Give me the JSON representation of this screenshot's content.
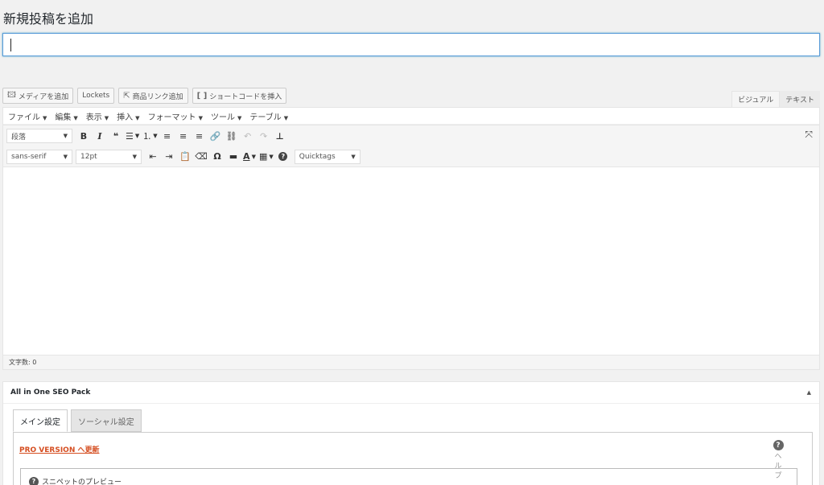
{
  "page": {
    "title": "新規投稿を追加"
  },
  "title_input": {
    "value": ""
  },
  "media_buttons": [
    {
      "label": "メディアを追加",
      "icon": "media-icon"
    },
    {
      "label": "Lockets",
      "icon": ""
    },
    {
      "label": "商品リンク追加",
      "icon": "link-out-icon"
    },
    {
      "label": "ショートコードを挿入",
      "icon": "shortcode-icon"
    }
  ],
  "editor_tabs": {
    "visual": "ビジュアル",
    "text": "テキスト"
  },
  "menubar": [
    "ファイル",
    "編集",
    "表示",
    "挿入",
    "フォーマット",
    "ツール",
    "テーブル"
  ],
  "toolbar": {
    "format_select": "段落",
    "font_family_select": "sans-serif",
    "font_size_select": "12pt",
    "quicktags_select": "Quicktags",
    "icons": {
      "bold": "B",
      "italic": "I",
      "blockquote": "❝",
      "bullist": "☰",
      "numlist": "⒈",
      "align_left": "≡",
      "align_center": "≡",
      "align_right": "≡",
      "link": "🔗",
      "unlink": "⛓",
      "undo": "↶",
      "redo": "↷",
      "special": "⊥",
      "fullscreen": "⤧",
      "outdent": "⇤",
      "indent": "⇥",
      "paste_text": "📋",
      "clear_format": "⌫",
      "omega": "Ω",
      "hr": "▬",
      "text_color": "A",
      "table": "▦",
      "help": "?"
    }
  },
  "statusbar": {
    "word_count": "文字数: 0"
  },
  "seo": {
    "title": "All in One SEO Pack",
    "toggle": "▲",
    "tabs": [
      "メイン設定",
      "ソーシャル設定"
    ],
    "pro_link": "PRO VERSION へ更新",
    "help_label": "ヘルプ",
    "snippet_label": "スニペットのプレビュー"
  }
}
